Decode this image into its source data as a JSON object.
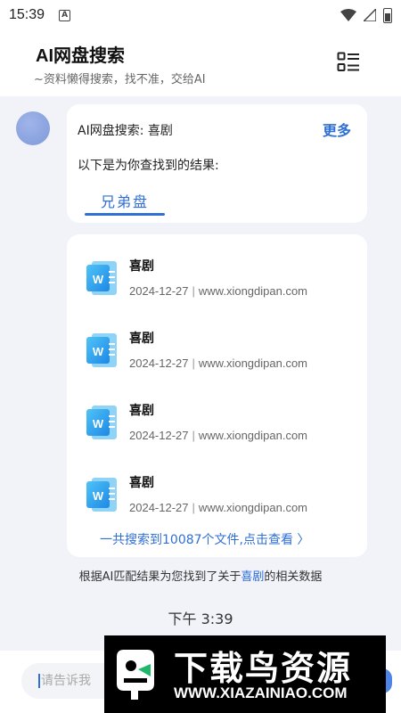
{
  "status_bar": {
    "time": "15:39",
    "notification_letter": "A"
  },
  "header": {
    "title": "AI网盘搜索",
    "subtitle": "~资料懒得搜索，找不准，交给AI"
  },
  "result_card": {
    "search_label": "AI网盘搜索: 喜剧",
    "more_label": "更多",
    "intro": "以下是为你查找到的结果:",
    "tab_label": "兄弟盘"
  },
  "files": [
    {
      "name": "喜剧",
      "date": "2024-12-27",
      "source": "www.xiongdipan.com"
    },
    {
      "name": "喜剧",
      "date": "2024-12-27",
      "source": "www.xiongdipan.com"
    },
    {
      "name": "喜剧",
      "date": "2024-12-27",
      "source": "www.xiongdipan.com"
    },
    {
      "name": "喜剧",
      "date": "2024-12-27",
      "source": "www.xiongdipan.com"
    }
  ],
  "total_link": "一共搜索到10087个文件,点击查看 〉",
  "match_note": {
    "prefix": "根据AI匹配结果为您找到了关于",
    "keyword": "喜剧",
    "suffix": "的相关数据"
  },
  "timestamp": "下午 3:39",
  "input": {
    "placeholder": "请告诉我"
  },
  "watermark": {
    "title": "下载鸟资源",
    "url": "WWW.XIAZAINIAO.COM"
  },
  "colors": {
    "accent": "#2f6fd6",
    "background": "#f1f3f8"
  }
}
